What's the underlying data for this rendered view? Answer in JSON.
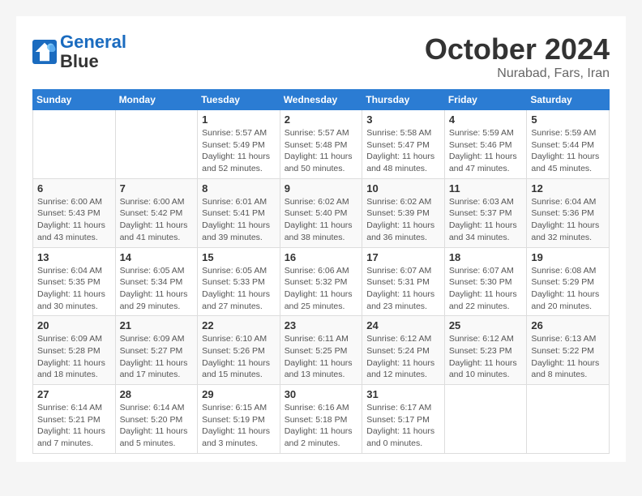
{
  "header": {
    "logo_line1": "General",
    "logo_line2": "Blue",
    "month": "October 2024",
    "location": "Nurabad, Fars, Iran"
  },
  "weekdays": [
    "Sunday",
    "Monday",
    "Tuesday",
    "Wednesday",
    "Thursday",
    "Friday",
    "Saturday"
  ],
  "weeks": [
    [
      {
        "day": "",
        "info": ""
      },
      {
        "day": "",
        "info": ""
      },
      {
        "day": "1",
        "info": "Sunrise: 5:57 AM\nSunset: 5:49 PM\nDaylight: 11 hours and 52 minutes."
      },
      {
        "day": "2",
        "info": "Sunrise: 5:57 AM\nSunset: 5:48 PM\nDaylight: 11 hours and 50 minutes."
      },
      {
        "day": "3",
        "info": "Sunrise: 5:58 AM\nSunset: 5:47 PM\nDaylight: 11 hours and 48 minutes."
      },
      {
        "day": "4",
        "info": "Sunrise: 5:59 AM\nSunset: 5:46 PM\nDaylight: 11 hours and 47 minutes."
      },
      {
        "day": "5",
        "info": "Sunrise: 5:59 AM\nSunset: 5:44 PM\nDaylight: 11 hours and 45 minutes."
      }
    ],
    [
      {
        "day": "6",
        "info": "Sunrise: 6:00 AM\nSunset: 5:43 PM\nDaylight: 11 hours and 43 minutes."
      },
      {
        "day": "7",
        "info": "Sunrise: 6:00 AM\nSunset: 5:42 PM\nDaylight: 11 hours and 41 minutes."
      },
      {
        "day": "8",
        "info": "Sunrise: 6:01 AM\nSunset: 5:41 PM\nDaylight: 11 hours and 39 minutes."
      },
      {
        "day": "9",
        "info": "Sunrise: 6:02 AM\nSunset: 5:40 PM\nDaylight: 11 hours and 38 minutes."
      },
      {
        "day": "10",
        "info": "Sunrise: 6:02 AM\nSunset: 5:39 PM\nDaylight: 11 hours and 36 minutes."
      },
      {
        "day": "11",
        "info": "Sunrise: 6:03 AM\nSunset: 5:37 PM\nDaylight: 11 hours and 34 minutes."
      },
      {
        "day": "12",
        "info": "Sunrise: 6:04 AM\nSunset: 5:36 PM\nDaylight: 11 hours and 32 minutes."
      }
    ],
    [
      {
        "day": "13",
        "info": "Sunrise: 6:04 AM\nSunset: 5:35 PM\nDaylight: 11 hours and 30 minutes."
      },
      {
        "day": "14",
        "info": "Sunrise: 6:05 AM\nSunset: 5:34 PM\nDaylight: 11 hours and 29 minutes."
      },
      {
        "day": "15",
        "info": "Sunrise: 6:05 AM\nSunset: 5:33 PM\nDaylight: 11 hours and 27 minutes."
      },
      {
        "day": "16",
        "info": "Sunrise: 6:06 AM\nSunset: 5:32 PM\nDaylight: 11 hours and 25 minutes."
      },
      {
        "day": "17",
        "info": "Sunrise: 6:07 AM\nSunset: 5:31 PM\nDaylight: 11 hours and 23 minutes."
      },
      {
        "day": "18",
        "info": "Sunrise: 6:07 AM\nSunset: 5:30 PM\nDaylight: 11 hours and 22 minutes."
      },
      {
        "day": "19",
        "info": "Sunrise: 6:08 AM\nSunset: 5:29 PM\nDaylight: 11 hours and 20 minutes."
      }
    ],
    [
      {
        "day": "20",
        "info": "Sunrise: 6:09 AM\nSunset: 5:28 PM\nDaylight: 11 hours and 18 minutes."
      },
      {
        "day": "21",
        "info": "Sunrise: 6:09 AM\nSunset: 5:27 PM\nDaylight: 11 hours and 17 minutes."
      },
      {
        "day": "22",
        "info": "Sunrise: 6:10 AM\nSunset: 5:26 PM\nDaylight: 11 hours and 15 minutes."
      },
      {
        "day": "23",
        "info": "Sunrise: 6:11 AM\nSunset: 5:25 PM\nDaylight: 11 hours and 13 minutes."
      },
      {
        "day": "24",
        "info": "Sunrise: 6:12 AM\nSunset: 5:24 PM\nDaylight: 11 hours and 12 minutes."
      },
      {
        "day": "25",
        "info": "Sunrise: 6:12 AM\nSunset: 5:23 PM\nDaylight: 11 hours and 10 minutes."
      },
      {
        "day": "26",
        "info": "Sunrise: 6:13 AM\nSunset: 5:22 PM\nDaylight: 11 hours and 8 minutes."
      }
    ],
    [
      {
        "day": "27",
        "info": "Sunrise: 6:14 AM\nSunset: 5:21 PM\nDaylight: 11 hours and 7 minutes."
      },
      {
        "day": "28",
        "info": "Sunrise: 6:14 AM\nSunset: 5:20 PM\nDaylight: 11 hours and 5 minutes."
      },
      {
        "day": "29",
        "info": "Sunrise: 6:15 AM\nSunset: 5:19 PM\nDaylight: 11 hours and 3 minutes."
      },
      {
        "day": "30",
        "info": "Sunrise: 6:16 AM\nSunset: 5:18 PM\nDaylight: 11 hours and 2 minutes."
      },
      {
        "day": "31",
        "info": "Sunrise: 6:17 AM\nSunset: 5:17 PM\nDaylight: 11 hours and 0 minutes."
      },
      {
        "day": "",
        "info": ""
      },
      {
        "day": "",
        "info": ""
      }
    ]
  ]
}
